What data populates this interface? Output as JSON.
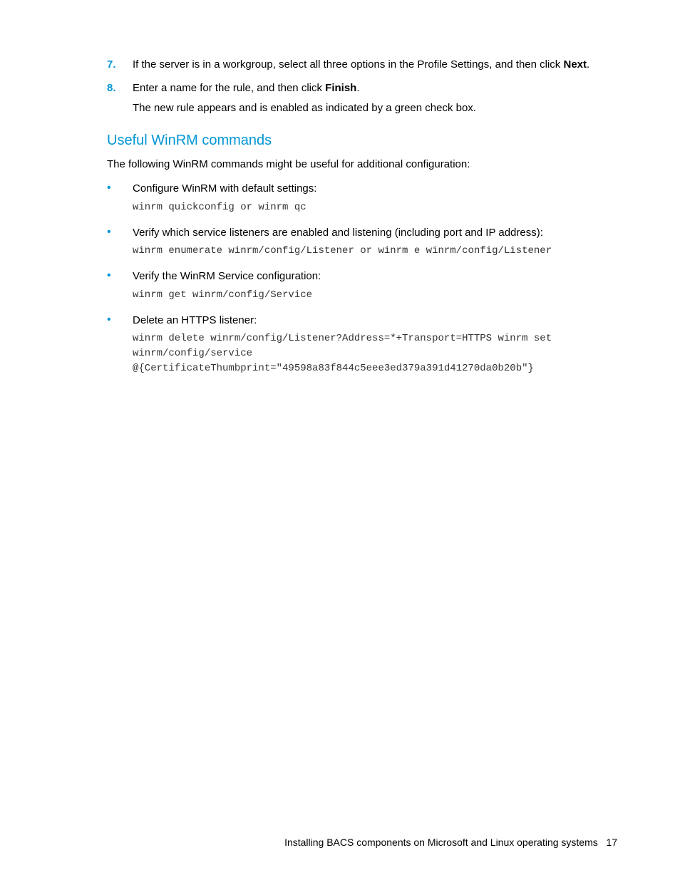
{
  "ordered": [
    {
      "num": "7.",
      "text_pre": "If the server is in a workgroup, select all three options in the Profile Settings, and then click ",
      "bold": "Next",
      "text_post": "."
    },
    {
      "num": "8.",
      "text_pre": "Enter a name for the rule, and then click ",
      "bold": "Finish",
      "text_post": ".",
      "subtext": "The new rule appears and is enabled as indicated by a green check box."
    }
  ],
  "heading": "Useful WinRM commands",
  "intro": "The following WinRM commands might be useful for additional configuration:",
  "bullets": [
    {
      "text": "Configure WinRM with default settings:",
      "code": "winrm quickconfig or winrm qc"
    },
    {
      "text": "Verify which service listeners are enabled and listening (including port and IP address):",
      "code": "winrm enumerate winrm/config/Listener or winrm e winrm/config/Listener"
    },
    {
      "text": "Verify the WinRM Service configuration:",
      "code": "winrm get winrm/config/Service"
    },
    {
      "text": "Delete an HTTPS listener:",
      "code": "winrm delete winrm/config/Listener?Address=*+Transport=HTTPS winrm set winrm/config/service @{CertificateThumbprint=\"49598a83f844c5eee3ed379a391d41270da0b20b\"}"
    }
  ],
  "footer_text": "Installing BACS components on Microsoft and Linux operating systems",
  "footer_page": "17"
}
